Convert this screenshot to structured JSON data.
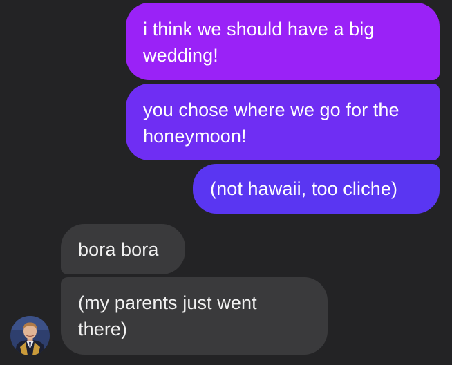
{
  "messages": {
    "sent": [
      {
        "text": "i think we should have a big wedding!",
        "color": "#9a22f7"
      },
      {
        "text": "you chose where we go for the honeymoon!",
        "color": "#6f2ef3"
      },
      {
        "text": "(not hawaii, too cliche)",
        "color": "#5a36f2"
      }
    ],
    "received": [
      {
        "text": "bora bora"
      },
      {
        "text": "(my parents just went there)"
      }
    ]
  },
  "colors": {
    "background": "#232325",
    "received_bubble": "#3a3a3c"
  }
}
